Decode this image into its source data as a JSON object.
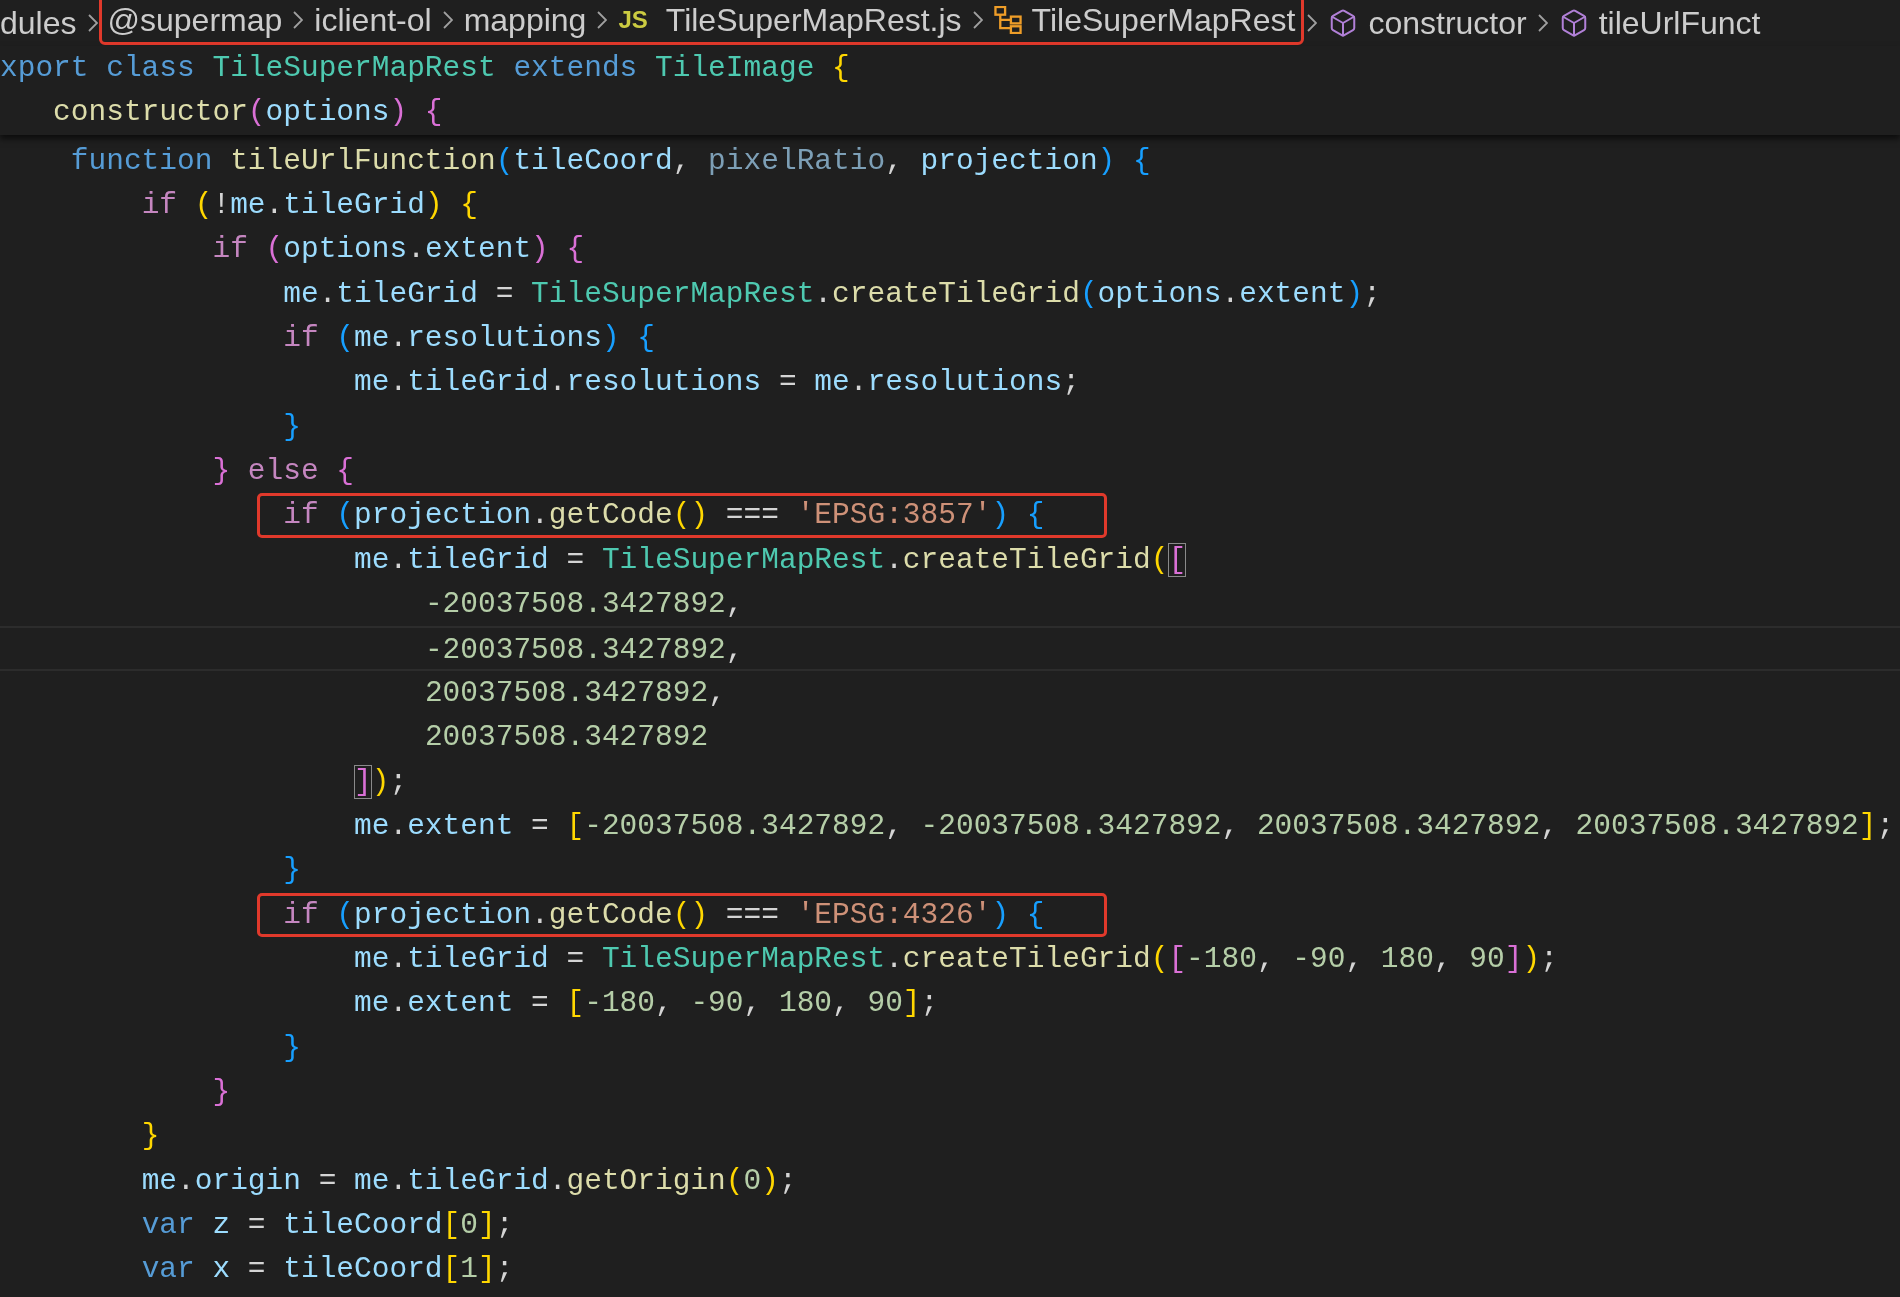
{
  "breadcrumb": {
    "items": [
      {
        "label": "dules",
        "kind": "folder",
        "annotated": false
      },
      {
        "label": "@supermap",
        "kind": "folder",
        "annotated": true
      },
      {
        "label": "iclient-ol",
        "kind": "folder",
        "annotated": true
      },
      {
        "label": "mapping",
        "kind": "folder",
        "annotated": true
      },
      {
        "label": "TileSuperMapRest.js",
        "kind": "file",
        "badge": "JS",
        "annotated": true
      },
      {
        "label": "TileSuperMapRest",
        "kind": "class",
        "annotated": true
      },
      {
        "label": "constructor",
        "kind": "method",
        "annotated": false
      },
      {
        "label": "tileUrlFunct",
        "kind": "method",
        "annotated": false
      }
    ]
  },
  "editor": {
    "sticky_lines": [
      {
        "tokens": [
          {
            "text": "xport",
            "kind": "kw"
          },
          {
            "text": " class",
            "kind": "kw"
          },
          {
            "text": " TileSuperMapRest",
            "kind": "cls"
          },
          {
            "text": " extends",
            "kind": "kw"
          },
          {
            "text": " TileImage",
            "kind": "cls"
          },
          {
            "text": " {",
            "kind": "b1"
          }
        ]
      },
      {
        "tokens": [
          {
            "text": "   constructor",
            "kind": "fn"
          },
          {
            "text": "(",
            "kind": "b2"
          },
          {
            "text": "options",
            "kind": "var"
          },
          {
            "text": ")",
            "kind": "b2"
          },
          {
            "text": " {",
            "kind": "b2"
          }
        ]
      }
    ],
    "lines": [
      {
        "annotated": false,
        "current": false,
        "tokens": [
          {
            "text": "    function",
            "kind": "kw"
          },
          {
            "text": " tileUrlFunction",
            "kind": "fn"
          },
          {
            "text": "(",
            "kind": "b3"
          },
          {
            "text": "tileCoord",
            "kind": "var"
          },
          {
            "text": ",",
            "kind": "plain"
          },
          {
            "text": " pixelRatio",
            "kind": "dim"
          },
          {
            "text": ",",
            "kind": "plain"
          },
          {
            "text": " projection",
            "kind": "var"
          },
          {
            "text": ")",
            "kind": "b3"
          },
          {
            "text": " {",
            "kind": "b3"
          }
        ]
      },
      {
        "annotated": false,
        "current": false,
        "tokens": [
          {
            "text": "        if",
            "kind": "ctl"
          },
          {
            "text": " (",
            "kind": "b1"
          },
          {
            "text": "!",
            "kind": "plain"
          },
          {
            "text": "me",
            "kind": "var"
          },
          {
            "text": ".",
            "kind": "plain"
          },
          {
            "text": "tileGrid",
            "kind": "var"
          },
          {
            "text": ")",
            "kind": "b1"
          },
          {
            "text": " {",
            "kind": "b1"
          }
        ]
      },
      {
        "annotated": false,
        "current": false,
        "tokens": [
          {
            "text": "            if",
            "kind": "ctl"
          },
          {
            "text": " (",
            "kind": "b2"
          },
          {
            "text": "options",
            "kind": "var"
          },
          {
            "text": ".",
            "kind": "plain"
          },
          {
            "text": "extent",
            "kind": "var"
          },
          {
            "text": ")",
            "kind": "b2"
          },
          {
            "text": " {",
            "kind": "b2"
          }
        ]
      },
      {
        "annotated": false,
        "current": false,
        "tokens": [
          {
            "text": "                me",
            "kind": "var"
          },
          {
            "text": ".",
            "kind": "plain"
          },
          {
            "text": "tileGrid",
            "kind": "var"
          },
          {
            "text": " = ",
            "kind": "plain"
          },
          {
            "text": "TileSuperMapRest",
            "kind": "cls"
          },
          {
            "text": ".",
            "kind": "plain"
          },
          {
            "text": "createTileGrid",
            "kind": "fn"
          },
          {
            "text": "(",
            "kind": "b3"
          },
          {
            "text": "options",
            "kind": "var"
          },
          {
            "text": ".",
            "kind": "plain"
          },
          {
            "text": "extent",
            "kind": "var"
          },
          {
            "text": ")",
            "kind": "b3"
          },
          {
            "text": ";",
            "kind": "plain"
          }
        ]
      },
      {
        "annotated": false,
        "current": false,
        "tokens": [
          {
            "text": "                if",
            "kind": "ctl"
          },
          {
            "text": " (",
            "kind": "b3"
          },
          {
            "text": "me",
            "kind": "var"
          },
          {
            "text": ".",
            "kind": "plain"
          },
          {
            "text": "resolutions",
            "kind": "var"
          },
          {
            "text": ")",
            "kind": "b3"
          },
          {
            "text": " {",
            "kind": "b3"
          }
        ]
      },
      {
        "annotated": false,
        "current": false,
        "tokens": [
          {
            "text": "                    me",
            "kind": "var"
          },
          {
            "text": ".",
            "kind": "plain"
          },
          {
            "text": "tileGrid",
            "kind": "var"
          },
          {
            "text": ".",
            "kind": "plain"
          },
          {
            "text": "resolutions",
            "kind": "var"
          },
          {
            "text": " = ",
            "kind": "plain"
          },
          {
            "text": "me",
            "kind": "var"
          },
          {
            "text": ".",
            "kind": "plain"
          },
          {
            "text": "resolutions",
            "kind": "var"
          },
          {
            "text": ";",
            "kind": "plain"
          }
        ]
      },
      {
        "annotated": false,
        "current": false,
        "tokens": [
          {
            "text": "                }",
            "kind": "b3"
          }
        ]
      },
      {
        "annotated": false,
        "current": false,
        "tokens": [
          {
            "text": "            }",
            "kind": "b2"
          },
          {
            "text": " else",
            "kind": "ctl"
          },
          {
            "text": " {",
            "kind": "b2"
          }
        ]
      },
      {
        "annotated": true,
        "current": false,
        "tokens": [
          {
            "text": "                if",
            "kind": "ctl"
          },
          {
            "text": " (",
            "kind": "b3"
          },
          {
            "text": "projection",
            "kind": "var"
          },
          {
            "text": ".",
            "kind": "plain"
          },
          {
            "text": "getCode",
            "kind": "fn"
          },
          {
            "text": "()",
            "kind": "b1"
          },
          {
            "text": " === ",
            "kind": "plain"
          },
          {
            "text": "'EPSG:3857'",
            "kind": "str"
          },
          {
            "text": ")",
            "kind": "b3"
          },
          {
            "text": " {",
            "kind": "b3"
          }
        ]
      },
      {
        "annotated": false,
        "current": false,
        "tokens": [
          {
            "text": "                    me",
            "kind": "var"
          },
          {
            "text": ".",
            "kind": "plain"
          },
          {
            "text": "tileGrid",
            "kind": "var"
          },
          {
            "text": " = ",
            "kind": "plain"
          },
          {
            "text": "TileSuperMapRest",
            "kind": "cls"
          },
          {
            "text": ".",
            "kind": "plain"
          },
          {
            "text": "createTileGrid",
            "kind": "fn"
          },
          {
            "text": "(",
            "kind": "b1"
          },
          {
            "text": "[",
            "kind": "bm"
          }
        ]
      },
      {
        "annotated": false,
        "current": false,
        "tokens": [
          {
            "text": "                        -20037508.3427892",
            "kind": "num"
          },
          {
            "text": ",",
            "kind": "plain"
          }
        ]
      },
      {
        "annotated": false,
        "current": true,
        "tokens": [
          {
            "text": "                        -20037508.3427892",
            "kind": "num"
          },
          {
            "text": ",",
            "kind": "plain"
          }
        ]
      },
      {
        "annotated": false,
        "current": false,
        "tokens": [
          {
            "text": "                        20037508.3427892",
            "kind": "num"
          },
          {
            "text": ",",
            "kind": "plain"
          }
        ]
      },
      {
        "annotated": false,
        "current": false,
        "tokens": [
          {
            "text": "                        20037508.3427892",
            "kind": "num"
          }
        ]
      },
      {
        "annotated": false,
        "current": false,
        "tokens": [
          {
            "text": "                    ]",
            "kind": "bm"
          },
          {
            "text": ")",
            "kind": "b1"
          },
          {
            "text": ";",
            "kind": "plain"
          }
        ]
      },
      {
        "annotated": false,
        "current": false,
        "tokens": [
          {
            "text": "                    me",
            "kind": "var"
          },
          {
            "text": ".",
            "kind": "plain"
          },
          {
            "text": "extent",
            "kind": "var"
          },
          {
            "text": " = ",
            "kind": "plain"
          },
          {
            "text": "[",
            "kind": "b1"
          },
          {
            "text": "-20037508.3427892",
            "kind": "num"
          },
          {
            "text": ",",
            "kind": "plain"
          },
          {
            "text": " -20037508.3427892",
            "kind": "num"
          },
          {
            "text": ",",
            "kind": "plain"
          },
          {
            "text": " 20037508.3427892",
            "kind": "num"
          },
          {
            "text": ",",
            "kind": "plain"
          },
          {
            "text": " 20037508.3427892",
            "kind": "num"
          },
          {
            "text": "]",
            "kind": "b1"
          },
          {
            "text": ";",
            "kind": "plain"
          }
        ]
      },
      {
        "annotated": false,
        "current": false,
        "tokens": [
          {
            "text": "                }",
            "kind": "b3"
          }
        ]
      },
      {
        "annotated": true,
        "current": false,
        "tokens": [
          {
            "text": "                if",
            "kind": "ctl"
          },
          {
            "text": " (",
            "kind": "b3"
          },
          {
            "text": "projection",
            "kind": "var"
          },
          {
            "text": ".",
            "kind": "plain"
          },
          {
            "text": "getCode",
            "kind": "fn"
          },
          {
            "text": "()",
            "kind": "b1"
          },
          {
            "text": " === ",
            "kind": "plain"
          },
          {
            "text": "'EPSG:4326'",
            "kind": "str"
          },
          {
            "text": ")",
            "kind": "b3"
          },
          {
            "text": " {",
            "kind": "b3"
          }
        ]
      },
      {
        "annotated": false,
        "current": false,
        "tokens": [
          {
            "text": "                    me",
            "kind": "var"
          },
          {
            "text": ".",
            "kind": "plain"
          },
          {
            "text": "tileGrid",
            "kind": "var"
          },
          {
            "text": " = ",
            "kind": "plain"
          },
          {
            "text": "TileSuperMapRest",
            "kind": "cls"
          },
          {
            "text": ".",
            "kind": "plain"
          },
          {
            "text": "createTileGrid",
            "kind": "fn"
          },
          {
            "text": "(",
            "kind": "b1"
          },
          {
            "text": "[",
            "kind": "b2"
          },
          {
            "text": "-180",
            "kind": "num"
          },
          {
            "text": ",",
            "kind": "plain"
          },
          {
            "text": " -90",
            "kind": "num"
          },
          {
            "text": ",",
            "kind": "plain"
          },
          {
            "text": " 180",
            "kind": "num"
          },
          {
            "text": ",",
            "kind": "plain"
          },
          {
            "text": " 90",
            "kind": "num"
          },
          {
            "text": "]",
            "kind": "b2"
          },
          {
            "text": ")",
            "kind": "b1"
          },
          {
            "text": ";",
            "kind": "plain"
          }
        ]
      },
      {
        "annotated": false,
        "current": false,
        "tokens": [
          {
            "text": "                    me",
            "kind": "var"
          },
          {
            "text": ".",
            "kind": "plain"
          },
          {
            "text": "extent",
            "kind": "var"
          },
          {
            "text": " = ",
            "kind": "plain"
          },
          {
            "text": "[",
            "kind": "b1"
          },
          {
            "text": "-180",
            "kind": "num"
          },
          {
            "text": ",",
            "kind": "plain"
          },
          {
            "text": " -90",
            "kind": "num"
          },
          {
            "text": ",",
            "kind": "plain"
          },
          {
            "text": " 180",
            "kind": "num"
          },
          {
            "text": ",",
            "kind": "plain"
          },
          {
            "text": " 90",
            "kind": "num"
          },
          {
            "text": "]",
            "kind": "b1"
          },
          {
            "text": ";",
            "kind": "plain"
          }
        ]
      },
      {
        "annotated": false,
        "current": false,
        "tokens": [
          {
            "text": "                }",
            "kind": "b3"
          }
        ]
      },
      {
        "annotated": false,
        "current": false,
        "tokens": [
          {
            "text": "            }",
            "kind": "b2"
          }
        ]
      },
      {
        "annotated": false,
        "current": false,
        "tokens": [
          {
            "text": "        }",
            "kind": "b1"
          }
        ]
      },
      {
        "annotated": false,
        "current": false,
        "tokens": [
          {
            "text": "        me",
            "kind": "var"
          },
          {
            "text": ".",
            "kind": "plain"
          },
          {
            "text": "origin",
            "kind": "var"
          },
          {
            "text": " = ",
            "kind": "plain"
          },
          {
            "text": "me",
            "kind": "var"
          },
          {
            "text": ".",
            "kind": "plain"
          },
          {
            "text": "tileGrid",
            "kind": "var"
          },
          {
            "text": ".",
            "kind": "plain"
          },
          {
            "text": "getOrigin",
            "kind": "fn"
          },
          {
            "text": "(",
            "kind": "b1"
          },
          {
            "text": "0",
            "kind": "num"
          },
          {
            "text": ")",
            "kind": "b1"
          },
          {
            "text": ";",
            "kind": "plain"
          }
        ]
      },
      {
        "annotated": false,
        "current": false,
        "tokens": [
          {
            "text": "        var",
            "kind": "kw"
          },
          {
            "text": " z",
            "kind": "var"
          },
          {
            "text": " = ",
            "kind": "plain"
          },
          {
            "text": "tileCoord",
            "kind": "var"
          },
          {
            "text": "[",
            "kind": "b1"
          },
          {
            "text": "0",
            "kind": "num"
          },
          {
            "text": "]",
            "kind": "b1"
          },
          {
            "text": ";",
            "kind": "plain"
          }
        ]
      },
      {
        "annotated": false,
        "current": false,
        "tokens": [
          {
            "text": "        var",
            "kind": "kw"
          },
          {
            "text": " x",
            "kind": "var"
          },
          {
            "text": " = ",
            "kind": "plain"
          },
          {
            "text": "tileCoord",
            "kind": "var"
          },
          {
            "text": "[",
            "kind": "b1"
          },
          {
            "text": "1",
            "kind": "num"
          },
          {
            "text": "]",
            "kind": "b1"
          },
          {
            "text": ";",
            "kind": "plain"
          }
        ]
      }
    ]
  }
}
